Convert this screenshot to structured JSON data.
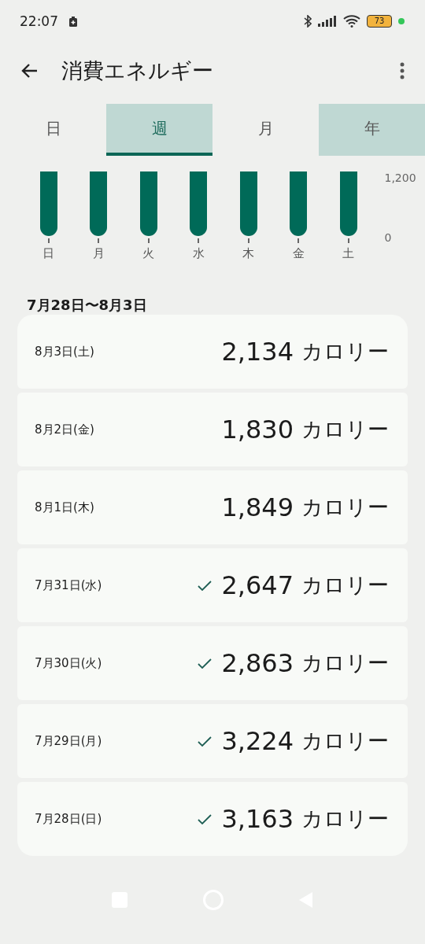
{
  "status_bar": {
    "time": "22:07",
    "battery": "73"
  },
  "header": {
    "title": "消費エネルギー"
  },
  "tabs": [
    {
      "label": "日",
      "selected": false,
      "pressed": false
    },
    {
      "label": "週",
      "selected": true,
      "pressed": false
    },
    {
      "label": "月",
      "selected": false,
      "pressed": false
    },
    {
      "label": "年",
      "selected": false,
      "pressed": true
    }
  ],
  "chart": {
    "y_labels": [
      "1,200",
      "0"
    ],
    "days": [
      "日",
      "月",
      "火",
      "水",
      "木",
      "金",
      "土"
    ]
  },
  "range": "7月28日〜8月3日",
  "rows": [
    {
      "date": "8月3日(土)",
      "value": "2,134",
      "unit": "カロリー",
      "goal_met": false
    },
    {
      "date": "8月2日(金)",
      "value": "1,830",
      "unit": "カロリー",
      "goal_met": false
    },
    {
      "date": "8月1日(木)",
      "value": "1,849",
      "unit": "カロリー",
      "goal_met": false
    },
    {
      "date": "7月31日(水)",
      "value": "2,647",
      "unit": "カロリー",
      "goal_met": true
    },
    {
      "date": "7月30日(火)",
      "value": "2,863",
      "unit": "カロリー",
      "goal_met": true
    },
    {
      "date": "7月29日(月)",
      "value": "3,224",
      "unit": "カロリー",
      "goal_met": true
    },
    {
      "date": "7月28日(日)",
      "value": "3,163",
      "unit": "カロリー",
      "goal_met": true
    }
  ]
}
